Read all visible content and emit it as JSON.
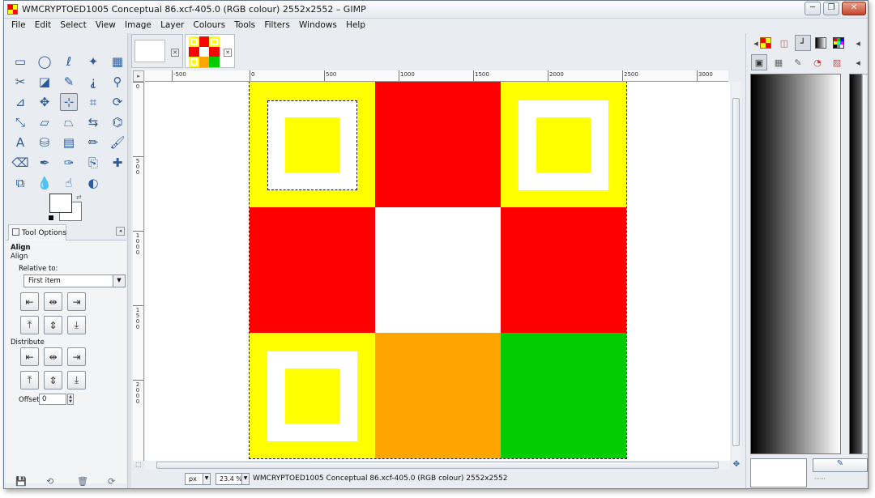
{
  "window": {
    "title": "WMCRYPTOED1005 Conceptual 86.xcf-405.0 (RGB colour) 2552x2552 – GIMP",
    "controls": {
      "minimize": "─",
      "maximize": "❐",
      "close": "✕"
    }
  },
  "menubar": [
    "File",
    "Edit",
    "Select",
    "View",
    "Image",
    "Layer",
    "Colours",
    "Tools",
    "Filters",
    "Windows",
    "Help"
  ],
  "toolbox": {
    "tools": [
      {
        "name": "rect-select-icon",
        "glyph": "▭"
      },
      {
        "name": "ellipse-select-icon",
        "glyph": "◯"
      },
      {
        "name": "free-select-icon",
        "glyph": "ℓ"
      },
      {
        "name": "fuzzy-select-icon",
        "glyph": "✦"
      },
      {
        "name": "by-color-select-icon",
        "glyph": "▦"
      },
      {
        "name": "scissors-select-icon",
        "glyph": "✂"
      },
      {
        "name": "foreground-select-icon",
        "glyph": "◪"
      },
      {
        "name": "paths-icon",
        "glyph": "✎"
      },
      {
        "name": "color-picker-icon",
        "glyph": "⸘"
      },
      {
        "name": "zoom-icon",
        "glyph": "⚲"
      },
      {
        "name": "measure-icon",
        "glyph": "⊿"
      },
      {
        "name": "move-icon",
        "glyph": "✥"
      },
      {
        "name": "align-icon",
        "glyph": "⊹"
      },
      {
        "name": "crop-icon",
        "glyph": "⌗"
      },
      {
        "name": "rotate-icon",
        "glyph": "⟳"
      },
      {
        "name": "scale-icon",
        "glyph": "⤡"
      },
      {
        "name": "shear-icon",
        "glyph": "▱"
      },
      {
        "name": "perspective-icon",
        "glyph": "⏢"
      },
      {
        "name": "flip-icon",
        "glyph": "⇆"
      },
      {
        "name": "cage-icon",
        "glyph": "⌬"
      },
      {
        "name": "text-icon",
        "glyph": "A"
      },
      {
        "name": "bucket-fill-icon",
        "glyph": "⛁"
      },
      {
        "name": "blend-icon",
        "glyph": "▤"
      },
      {
        "name": "pencil-icon",
        "glyph": "✏"
      },
      {
        "name": "paintbrush-icon",
        "glyph": "🖌"
      },
      {
        "name": "eraser-icon",
        "glyph": "⌫"
      },
      {
        "name": "airbrush-icon",
        "glyph": "✒"
      },
      {
        "name": "ink-icon",
        "glyph": "✑"
      },
      {
        "name": "clone-icon",
        "glyph": "⎘"
      },
      {
        "name": "heal-icon",
        "glyph": "✚"
      },
      {
        "name": "perspective-clone-icon",
        "glyph": "⧉"
      },
      {
        "name": "blur-icon",
        "glyph": "💧"
      },
      {
        "name": "smudge-icon",
        "glyph": "☝"
      },
      {
        "name": "dodge-burn-icon",
        "glyph": "◐"
      }
    ],
    "active_tool_index": 12,
    "swap_glyph": "⇄",
    "tool_options": {
      "tab_label": "Tool Options",
      "collapse_glyph": "◂",
      "heading": "Align",
      "subheading": "Align",
      "relative_label": "Relative to:",
      "relative_value": "First item",
      "distribute_label": "Distribute",
      "offset_label": "Offset:",
      "offset_value": "0",
      "align_buttons": [
        "⇤",
        "⇹",
        "⇥",
        "⤒",
        "⇕",
        "⤓"
      ],
      "distribute_buttons": [
        "⇤",
        "⇹",
        "⇥",
        "⤒",
        "⇕",
        "⤓"
      ]
    },
    "bottom_icons": [
      "💾",
      "⟲",
      "🗑",
      "⟳"
    ]
  },
  "image_tabs": {
    "close_glyph": "✕"
  },
  "rulers": {
    "h_labels": [
      "-500",
      "0",
      "500",
      "1000",
      "1500",
      "2000",
      "2500",
      "3000"
    ],
    "v_labels": [
      "0",
      "500",
      "1000",
      "1500",
      "2000"
    ]
  },
  "canvas": {
    "grid": [
      [
        "yellow-framed",
        "red",
        "yellow-framed"
      ],
      [
        "red",
        "white",
        "red"
      ],
      [
        "yellow-framed",
        "orange",
        "green"
      ]
    ],
    "colors": {
      "yellow": "#ffff00",
      "red": "#ff0000",
      "white": "#ffffff",
      "orange": "#ffa500",
      "green": "#00cc00"
    }
  },
  "statusbar": {
    "unit": "px",
    "zoom": "23.4 %",
    "message": "WMCRYPTOED1005 Conceptual 86.xcf-405.0 (RGB colour) 2552x2552"
  },
  "right_dock": {
    "tab_icons": [
      "pattern-icon",
      "brushes-icon",
      "tool-presets-icon",
      "gradients-icon",
      "palettes-icon"
    ],
    "tab_icons2": [
      "layers-icon",
      "channels-icon",
      "paths-icon",
      "undo-icon",
      "colourmap-icon"
    ]
  }
}
